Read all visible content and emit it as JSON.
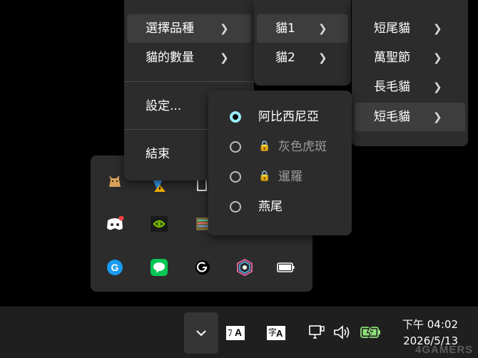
{
  "main_menu": {
    "items": [
      {
        "label": "選擇品種"
      },
      {
        "label": "貓的數量"
      },
      {
        "label": "設定..."
      },
      {
        "label": "結束"
      }
    ]
  },
  "cat_submenu": {
    "items": [
      {
        "label": "貓1"
      },
      {
        "label": "貓2"
      }
    ]
  },
  "breed_submenu": {
    "items": [
      {
        "label": "短尾貓"
      },
      {
        "label": "萬聖節"
      },
      {
        "label": "長毛貓"
      },
      {
        "label": "短毛貓"
      }
    ]
  },
  "variant_submenu": {
    "items": [
      {
        "label": "阿比西尼亞",
        "selected": true,
        "locked": false
      },
      {
        "label": "灰色虎斑",
        "selected": false,
        "locked": true
      },
      {
        "label": "暹羅",
        "selected": false,
        "locked": true
      },
      {
        "label": "燕尾",
        "selected": false,
        "locked": false
      }
    ]
  },
  "taskbar": {
    "time": "下午 04:02",
    "date": "2026/5/13",
    "ime_label_1": "A",
    "ime_label_2": "A"
  },
  "watermark": "4GAMERS",
  "icons": {
    "chevron": "chevron-right-icon",
    "tray_toggle": "chevron-down-icon",
    "network": "network-icon",
    "volume": "volume-icon",
    "battery": "battery-icon"
  },
  "colors": {
    "menu_bg": "#2c2c2c",
    "menu_highlight": "#3d3d3d",
    "radio_accent": "#99ebff",
    "taskbar_bg": "#1f1f1f",
    "line_green": "#06c755",
    "google_blue": "#1a9bf0",
    "discord": "#5865f2",
    "nvidia": "#76b900"
  }
}
